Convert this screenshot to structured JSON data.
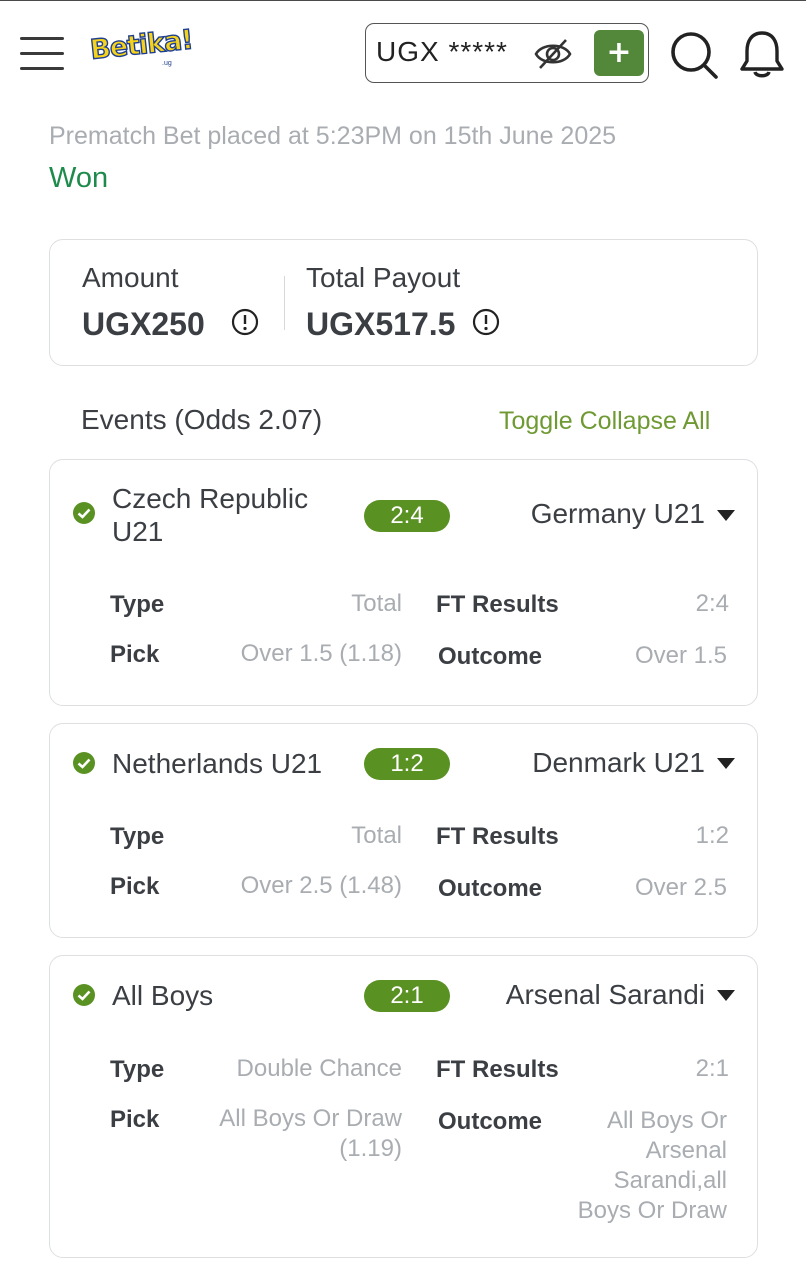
{
  "header": {
    "logo_text": "Betika!",
    "logo_sub": ".ug",
    "balance_masked": "UGX *****",
    "deposit_label": "+"
  },
  "bet": {
    "info": "Prematch Bet placed at 5:23PM on 15th June 2025",
    "status": "Won"
  },
  "summary": {
    "amount_label": "Amount",
    "amount_value": "UGX250",
    "payout_label": "Total Payout",
    "payout_value": "UGX517.5"
  },
  "events_section": {
    "title": "Events (Odds 2.07)",
    "toggle_label": "Toggle Collapse All"
  },
  "events": [
    {
      "home": "Czech Republic\nU21",
      "score": "2:4",
      "away": "Germany U21",
      "type_label": "Type",
      "type_value": "Total",
      "ft_label": "FT Results",
      "ft_value": "2:4",
      "pick_label": "Pick",
      "pick_value": "Over 1.5 (1.18)",
      "outcome_label": "Outcome",
      "outcome_value": "Over 1.5"
    },
    {
      "home": "Netherlands U21",
      "score": "1:2",
      "away": "Denmark U21",
      "type_label": "Type",
      "type_value": "Total",
      "ft_label": "FT Results",
      "ft_value": "1:2",
      "pick_label": "Pick",
      "pick_value": "Over 2.5 (1.48)",
      "outcome_label": "Outcome",
      "outcome_value": "Over 2.5"
    },
    {
      "home": "All Boys",
      "score": "2:1",
      "away": "Arsenal Sarandi",
      "type_label": "Type",
      "type_value": "Double Chance",
      "ft_label": "FT Results",
      "ft_value": "2:1",
      "pick_label": "Pick",
      "pick_value": "All Boys Or Draw\n(1.19)",
      "outcome_label": "Outcome",
      "outcome_value": "All Boys Or\nArsenal\nSarandi,all\nBoys Or Draw"
    }
  ],
  "colors": {
    "accent_green": "#53873a",
    "won_green": "#1e8a4c",
    "score_pill": "#5a9123",
    "link_green": "#6f9a33"
  }
}
